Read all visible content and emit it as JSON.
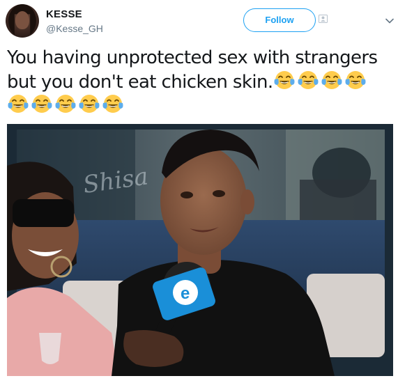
{
  "user": {
    "display_name": "KESSE",
    "handle": "@Kesse_GH"
  },
  "header": {
    "follow_label": "Follow",
    "more_icon": "chevron-down-icon"
  },
  "tweet": {
    "text": "You having unprotected sex with strangers but you don't eat chicken skin.",
    "emoji": "face-with-tears-of-joy",
    "emoji_count_line1": 4,
    "emoji_count_line2": 5
  },
  "media": {
    "background_sign_text": "Shisa",
    "microphone_logo": "e",
    "colors": {
      "mic_blue": "#1a8fd8",
      "sofa_blue": "#2f4a6e",
      "shirt": "#111111",
      "pink_top": "#e8a9a8"
    }
  },
  "colors": {
    "accent": "#1da1f2",
    "text": "#14171a",
    "secondary": "#657786"
  }
}
